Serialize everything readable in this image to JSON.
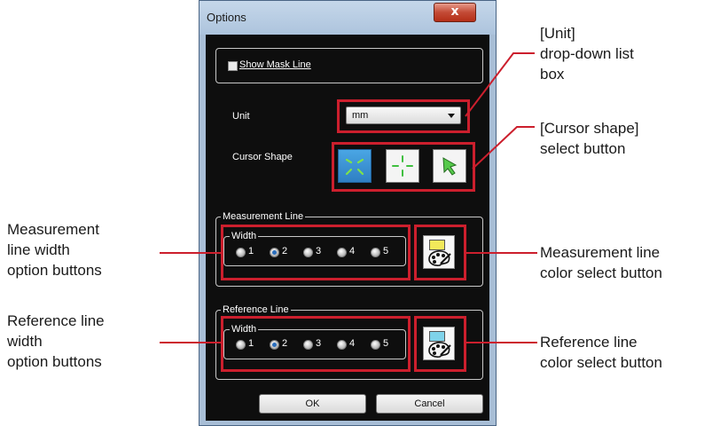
{
  "window": {
    "title": "Options",
    "close_glyph": "x"
  },
  "show_mask_line": {
    "label": "Show Mask Line",
    "checked": false
  },
  "unit": {
    "label": "Unit",
    "value": "mm"
  },
  "cursor_shape": {
    "label": "Cursor Shape",
    "selected": "cross-corners",
    "options": [
      "cross-corners",
      "crosshair",
      "arrow"
    ]
  },
  "measurement_line": {
    "legend": "Measurement Line",
    "width_legend": "Width",
    "options": [
      "1",
      "2",
      "3",
      "4",
      "5"
    ],
    "selected": "2",
    "swatch_color": "#f2e95a"
  },
  "reference_line": {
    "legend": "Reference Line",
    "width_legend": "Width",
    "options": [
      "1",
      "2",
      "3",
      "4",
      "5"
    ],
    "selected": "2",
    "swatch_color": "#7fd3ea"
  },
  "buttons": {
    "ok": "OK",
    "cancel": "Cancel"
  },
  "callouts": {
    "unit": "[Unit]\ndrop-down list\nbox",
    "cursor": "[Cursor shape]\nselect button",
    "meas_width": "Measurement\nline width\noption buttons",
    "meas_color": "Measurement line\ncolor select button",
    "ref_width": "Reference line\nwidth\noption buttons",
    "ref_color": "Reference line\ncolor select button"
  },
  "colors": {
    "highlight": "#cc1f2d",
    "selected_button": "#3a8fd3",
    "dialog_background": "#0e0e0e"
  }
}
